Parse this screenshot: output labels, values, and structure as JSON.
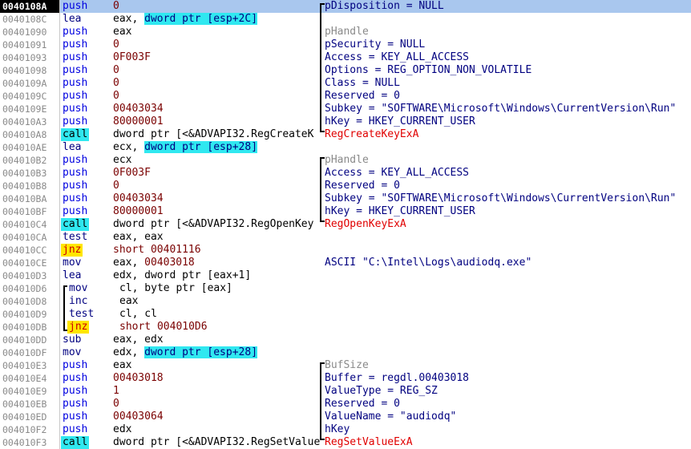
{
  "rows": [
    {
      "addr": "0040108A",
      "mn": "push",
      "mt": "push",
      "ops": [
        {
          "t": "0",
          "k": "c"
        }
      ],
      "com": "pDisposition = NULL",
      "ck": "",
      "sel": true
    },
    {
      "addr": "0040108C",
      "mn": "lea",
      "mt": "",
      "ops": [
        {
          "t": "eax, ",
          "k": ""
        },
        {
          "t": "dword ptr [esp+2C]",
          "k": "ptr"
        }
      ],
      "com": "",
      "ck": ""
    },
    {
      "addr": "00401090",
      "mn": "push",
      "mt": "push",
      "ops": [
        {
          "t": "eax",
          "k": ""
        }
      ],
      "com": "pHandle",
      "ck": "gray"
    },
    {
      "addr": "00401091",
      "mn": "push",
      "mt": "push",
      "ops": [
        {
          "t": "0",
          "k": "c"
        }
      ],
      "com": "pSecurity = NULL",
      "ck": ""
    },
    {
      "addr": "00401093",
      "mn": "push",
      "mt": "push",
      "ops": [
        {
          "t": "0F003F",
          "k": "c"
        }
      ],
      "com": "Access = KEY_ALL_ACCESS",
      "ck": ""
    },
    {
      "addr": "00401098",
      "mn": "push",
      "mt": "push",
      "ops": [
        {
          "t": "0",
          "k": "c"
        }
      ],
      "com": "Options = REG_OPTION_NON_VOLATILE",
      "ck": ""
    },
    {
      "addr": "0040109A",
      "mn": "push",
      "mt": "push",
      "ops": [
        {
          "t": "0",
          "k": "c"
        }
      ],
      "com": "Class = NULL",
      "ck": ""
    },
    {
      "addr": "0040109C",
      "mn": "push",
      "mt": "push",
      "ops": [
        {
          "t": "0",
          "k": "c"
        }
      ],
      "com": "Reserved = 0",
      "ck": ""
    },
    {
      "addr": "0040109E",
      "mn": "push",
      "mt": "push",
      "ops": [
        {
          "t": "00403034",
          "k": "c"
        }
      ],
      "com": "Subkey = \"SOFTWARE\\Microsoft\\Windows\\CurrentVersion\\Run\"",
      "ck": ""
    },
    {
      "addr": "004010A3",
      "mn": "push",
      "mt": "push",
      "ops": [
        {
          "t": "80000001",
          "k": "c"
        }
      ],
      "com": "hKey = HKEY_CURRENT_USER",
      "ck": ""
    },
    {
      "addr": "004010A8",
      "mn": "call",
      "mt": "cyan",
      "ops": [
        {
          "t": "dword ptr [<&ADVAPI32.RegCreateK",
          "k": ""
        }
      ],
      "com": "RegCreateKeyExA",
      "ck": "red"
    },
    {
      "addr": "004010AE",
      "mn": "lea",
      "mt": "",
      "ops": [
        {
          "t": "ecx, ",
          "k": ""
        },
        {
          "t": "dword ptr [esp+28]",
          "k": "ptr"
        }
      ],
      "com": "",
      "ck": ""
    },
    {
      "addr": "004010B2",
      "mn": "push",
      "mt": "push",
      "ops": [
        {
          "t": "ecx",
          "k": ""
        }
      ],
      "com": "pHandle",
      "ck": "gray"
    },
    {
      "addr": "004010B3",
      "mn": "push",
      "mt": "push",
      "ops": [
        {
          "t": "0F003F",
          "k": "c"
        }
      ],
      "com": "Access = KEY_ALL_ACCESS",
      "ck": ""
    },
    {
      "addr": "004010B8",
      "mn": "push",
      "mt": "push",
      "ops": [
        {
          "t": "0",
          "k": "c"
        }
      ],
      "com": "Reserved = 0",
      "ck": ""
    },
    {
      "addr": "004010BA",
      "mn": "push",
      "mt": "push",
      "ops": [
        {
          "t": "00403034",
          "k": "c"
        }
      ],
      "com": "Subkey = \"SOFTWARE\\Microsoft\\Windows\\CurrentVersion\\Run\"",
      "ck": ""
    },
    {
      "addr": "004010BF",
      "mn": "push",
      "mt": "push",
      "ops": [
        {
          "t": "80000001",
          "k": "c"
        }
      ],
      "com": "hKey = HKEY_CURRENT_USER",
      "ck": ""
    },
    {
      "addr": "004010C4",
      "mn": "call",
      "mt": "cyan",
      "ops": [
        {
          "t": "dword ptr [<&ADVAPI32.RegOpenKey",
          "k": ""
        }
      ],
      "com": "RegOpenKeyExA",
      "ck": "red"
    },
    {
      "addr": "004010CA",
      "mn": "test",
      "mt": "",
      "ops": [
        {
          "t": "eax, eax",
          "k": ""
        }
      ],
      "com": "",
      "ck": ""
    },
    {
      "addr": "004010CC",
      "mn": "jnz",
      "mt": "yellow",
      "ops": [
        {
          "t": "short 00401116",
          "k": "c"
        }
      ],
      "com": "",
      "ck": ""
    },
    {
      "addr": "004010CE",
      "mn": "mov",
      "mt": "",
      "ops": [
        {
          "t": "eax, ",
          "k": ""
        },
        {
          "t": "00403018",
          "k": "c"
        }
      ],
      "com": "ASCII \"C:\\Intel\\Logs\\audiodq.exe\"",
      "ck": ""
    },
    {
      "addr": "004010D3",
      "mn": "lea",
      "mt": "",
      "ops": [
        {
          "t": "edx, dword ptr [eax+1]",
          "k": ""
        }
      ],
      "com": "",
      "ck": ""
    },
    {
      "addr": "004010D6",
      "mn": "mov",
      "mt": "loop",
      "ops": [
        {
          "t": "cl, byte ptr [eax]",
          "k": ""
        }
      ],
      "com": "",
      "ck": ""
    },
    {
      "addr": "004010D8",
      "mn": "inc",
      "mt": "loop",
      "ops": [
        {
          "t": "eax",
          "k": ""
        }
      ],
      "com": "",
      "ck": ""
    },
    {
      "addr": "004010D9",
      "mn": "test",
      "mt": "loop",
      "ops": [
        {
          "t": "cl, cl",
          "k": ""
        }
      ],
      "com": "",
      "ck": ""
    },
    {
      "addr": "004010DB",
      "mn": "jnz",
      "mt": "loopjnz",
      "ops": [
        {
          "t": "short 004010D6",
          "k": "c"
        }
      ],
      "com": "",
      "ck": ""
    },
    {
      "addr": "004010DD",
      "mn": "sub",
      "mt": "",
      "ops": [
        {
          "t": "eax, edx",
          "k": ""
        }
      ],
      "com": "",
      "ck": ""
    },
    {
      "addr": "004010DF",
      "mn": "mov",
      "mt": "",
      "ops": [
        {
          "t": "edx, ",
          "k": ""
        },
        {
          "t": "dword ptr [esp+28]",
          "k": "ptr"
        }
      ],
      "com": "",
      "ck": ""
    },
    {
      "addr": "004010E3",
      "mn": "push",
      "mt": "push",
      "ops": [
        {
          "t": "eax",
          "k": ""
        }
      ],
      "com": "BufSize",
      "ck": "gray"
    },
    {
      "addr": "004010E4",
      "mn": "push",
      "mt": "push",
      "ops": [
        {
          "t": "00403018",
          "k": "c"
        }
      ],
      "com": "Buffer = regdl.00403018",
      "ck": ""
    },
    {
      "addr": "004010E9",
      "mn": "push",
      "mt": "push",
      "ops": [
        {
          "t": "1",
          "k": "c"
        }
      ],
      "com": "ValueType = REG_SZ",
      "ck": ""
    },
    {
      "addr": "004010EB",
      "mn": "push",
      "mt": "push",
      "ops": [
        {
          "t": "0",
          "k": "c"
        }
      ],
      "com": "Reserved = 0",
      "ck": ""
    },
    {
      "addr": "004010ED",
      "mn": "push",
      "mt": "push",
      "ops": [
        {
          "t": "00403064",
          "k": "c"
        }
      ],
      "com": "ValueName = \"audiodq\"",
      "ck": ""
    },
    {
      "addr": "004010F2",
      "mn": "push",
      "mt": "push",
      "ops": [
        {
          "t": "edx",
          "k": ""
        }
      ],
      "com": "hKey",
      "ck": ""
    },
    {
      "addr": "004010F3",
      "mn": "call",
      "mt": "cyan",
      "ops": [
        {
          "t": "dword ptr [<&ADVAPI32.RegSetValue",
          "k": ""
        }
      ],
      "com": "RegSetValueExA",
      "ck": "red"
    }
  ]
}
